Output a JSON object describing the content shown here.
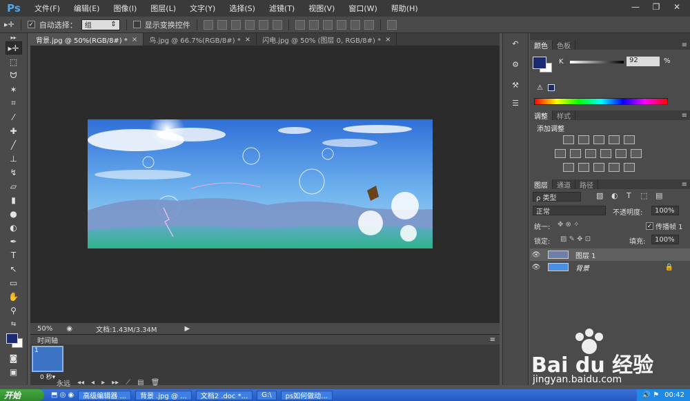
{
  "app": {
    "logo": "Ps"
  },
  "menu": [
    "文件(F)",
    "编辑(E)",
    "图像(I)",
    "图层(L)",
    "文字(Y)",
    "选择(S)",
    "滤镜(T)",
    "视图(V)",
    "窗口(W)",
    "帮助(H)"
  ],
  "window_controls": [
    "—",
    "❐",
    "✕"
  ],
  "options": {
    "auto_select_label": "自动选择：",
    "auto_select_value": "组",
    "transform_label": "显示变换控件"
  },
  "tabs": [
    {
      "label": "背景.jpg @ 50%(RGB/8#) *",
      "close": "×"
    },
    {
      "label": "鸟.jpg @ 66.7%(RGB/8#) *",
      "close": "×"
    },
    {
      "label": "闪电.jpg @ 50% (图层 0, RGB/8#) *",
      "close": "×"
    }
  ],
  "status": {
    "zoom": "50%",
    "doc": "文档:1.43M/3.34M"
  },
  "timeline": {
    "title": "时间轴",
    "frame_number": "1",
    "frame_delay": "0 秒▾",
    "loop": "永远"
  },
  "color_panel": {
    "tabs": [
      "颜色",
      "色板"
    ],
    "channel": "K",
    "value": "92",
    "unit": "%",
    "fg": "#1c2a73",
    "bg": "#ffffff"
  },
  "adjust_panel": {
    "tabs": [
      "调整",
      "样式"
    ],
    "title": "添加调整"
  },
  "layers_panel": {
    "tabs": [
      "图层",
      "通道",
      "路径"
    ],
    "filter": "ρ 类型",
    "blend_mode": "正常",
    "opacity_label": "不透明度:",
    "opacity": "100%",
    "unify_label": "统一:",
    "propagate_label": "传播帧 1",
    "lock_label": "锁定:",
    "fill_label": "填充:",
    "fill": "100%",
    "layers": [
      {
        "name": "图层 1"
      },
      {
        "name": "背景"
      }
    ]
  },
  "taskbar": {
    "start": "开始",
    "items": [
      "高级编辑器 ...",
      "背景 .jpg @ ...",
      "文档2 .doc *...",
      "G:\\",
      "ps如何做动..."
    ],
    "time": "00:42"
  },
  "watermark": {
    "brand": "Bai du 经验",
    "url": "jingyan.baidu.com"
  }
}
